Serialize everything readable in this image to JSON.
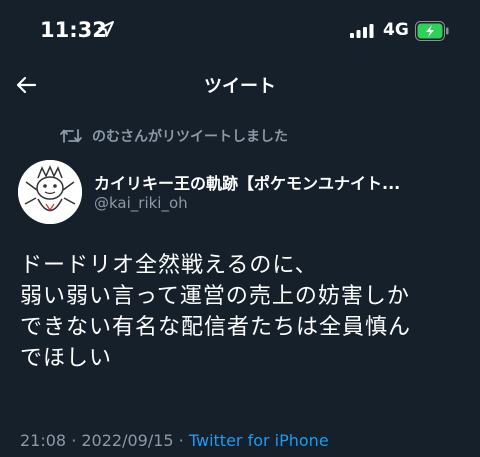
{
  "status_bar": {
    "time": "11:32",
    "network": "4G",
    "icons": [
      "location-arrow-icon",
      "signal-bars-icon",
      "battery-charging-icon"
    ],
    "battery_color": "#30d158"
  },
  "nav": {
    "title": "ツイート",
    "back_icon": "back-arrow-icon"
  },
  "retweet": {
    "icon": "retweet-icon",
    "text": "のむさんがリツイートしました"
  },
  "author": {
    "display_name": "カイリキー王の軌跡【ポケモンユナイト...",
    "handle": "@kai_riki_oh"
  },
  "tweet": {
    "text": "ドードリオ全然戦えるのに、\n弱い弱い言って運営の売上の妨害しか\nできない有名な配信者たちは全員慎ん\nでほしい"
  },
  "meta": {
    "time": "21:08",
    "separator1": " · ",
    "date": "2022/09/15",
    "separator2": " · ",
    "source": "Twitter for iPhone"
  },
  "colors": {
    "background": "#15202b",
    "secondary_text": "#8b98a5",
    "accent": "#1d9bf0"
  }
}
